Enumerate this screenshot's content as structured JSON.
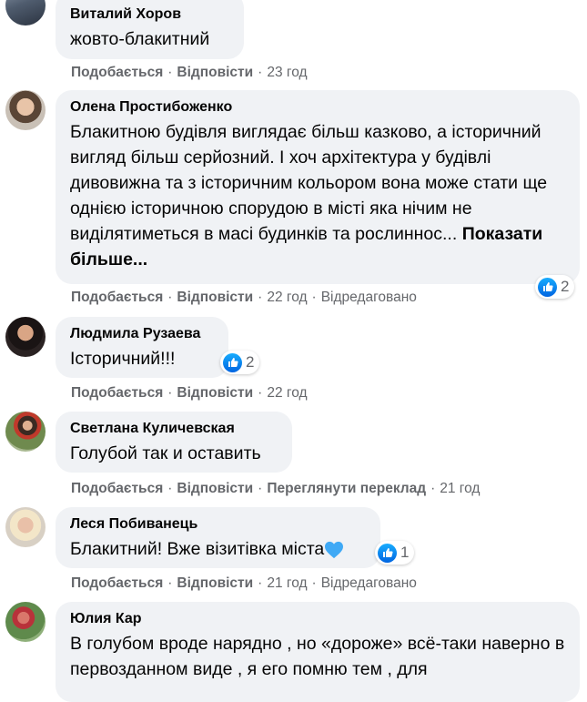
{
  "actions": {
    "like": "Подобається",
    "reply": "Відповісти",
    "translate": "Переглянути переклад",
    "edited": "Відредаговано",
    "separator": "·"
  },
  "comments": [
    {
      "author": "Виталий Хоров",
      "text": "жовто-блакитний",
      "time": "23 год"
    },
    {
      "author": "Олена Простибоженко",
      "text": "Блакитною будівля виглядає більш казково, а історичний вигляд більш серйозний. І хоч архітектура у будівлі дивовижна та з історичним кольором вона може стати ще однією історичною спорудою в місті яка нічим не виділятиметься в масі будинків та рослиннос...",
      "see_more": "Показати більше...",
      "time": "22 год",
      "reactions": "2"
    },
    {
      "author": "Людмила Рузаева",
      "text": "Історичний!!!",
      "time": "22 год",
      "reactions": "2"
    },
    {
      "author": "Светлана Куличевская",
      "text": "Голубой так и оставить",
      "time": "21 год"
    },
    {
      "author": "Леся Побиванець",
      "text": "Блакитний! Вже візитівка міста",
      "time": "21 год",
      "reactions": "1",
      "emoji": "blue-heart"
    },
    {
      "author": "Юлия Кар",
      "text": "В голубом вроде нарядно , но «дороже» всё-таки наверно в первозданном виде , я его помню тем , для"
    }
  ],
  "colors": {
    "bubble": "#f0f2f5",
    "meta": "#65676b",
    "like_blue": "#0866ff",
    "heart": "#3fa9f5"
  }
}
